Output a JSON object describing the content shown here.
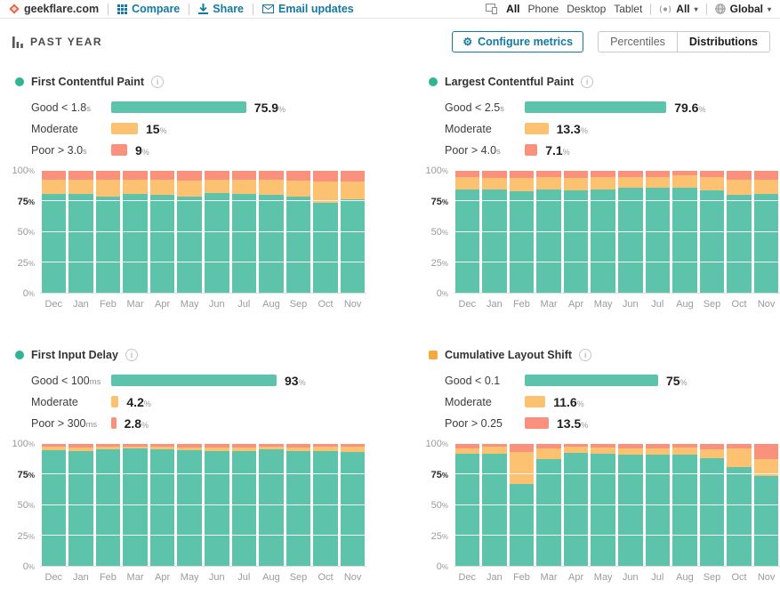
{
  "topbar": {
    "site": "geekflare.com",
    "links": [
      {
        "label": "Compare",
        "icon": "grid-icon"
      },
      {
        "label": "Share",
        "icon": "download-icon"
      },
      {
        "label": "Email updates",
        "icon": "envelope-icon"
      }
    ],
    "device_tabs": [
      {
        "label": "All",
        "selected": true
      },
      {
        "label": "Phone",
        "selected": false
      },
      {
        "label": "Desktop",
        "selected": false
      },
      {
        "label": "Tablet",
        "selected": false
      }
    ],
    "connection_dropdown": "All",
    "region_dropdown": "Global"
  },
  "toolbar": {
    "period": "PAST YEAR",
    "configure_label": "Configure metrics",
    "view_tabs": [
      {
        "label": "Percentiles",
        "selected": false
      },
      {
        "label": "Distributions",
        "selected": true
      }
    ]
  },
  "icons": {
    "gear": "⚙",
    "caret": "▾",
    "info": "i"
  },
  "colors": {
    "good": "#5ec3ab",
    "moderate": "#fcc171",
    "poor": "#f9917d",
    "accent": "#1379a2",
    "vitals_dot": "#2eb593",
    "cls_dot": "#f5a93f"
  },
  "y_ticks": [
    "100",
    "75",
    "50",
    "25",
    "0"
  ],
  "months": [
    "Dec",
    "Jan",
    "Feb",
    "Mar",
    "Apr",
    "May",
    "Jun",
    "Jul",
    "Aug",
    "Sep",
    "Oct",
    "Nov"
  ],
  "panels": [
    {
      "title": "First Contentful Paint",
      "marker_shape": "circle",
      "marker_color": "#2eb593",
      "legend": [
        {
          "label": "Good < 1.8",
          "unit": "s",
          "value": "75.9",
          "pct": 75.9,
          "color_key": "good"
        },
        {
          "label": "Moderate",
          "unit": "",
          "value": "15",
          "pct": 15,
          "color_key": "moderate"
        },
        {
          "label": "Poor > 3.0",
          "unit": "s",
          "value": "9",
          "pct": 9,
          "color_key": "poor"
        }
      ]
    },
    {
      "title": "Largest Contentful Paint",
      "marker_shape": "circle",
      "marker_color": "#2eb593",
      "legend": [
        {
          "label": "Good < 2.5",
          "unit": "s",
          "value": "79.6",
          "pct": 79.6,
          "color_key": "good"
        },
        {
          "label": "Moderate",
          "unit": "",
          "value": "13.3",
          "pct": 13.3,
          "color_key": "moderate"
        },
        {
          "label": "Poor > 4.0",
          "unit": "s",
          "value": "7.1",
          "pct": 7.1,
          "color_key": "poor"
        }
      ]
    },
    {
      "title": "First Input Delay",
      "marker_shape": "circle",
      "marker_color": "#2eb593",
      "legend": [
        {
          "label": "Good < 100",
          "unit": "ms",
          "value": "93",
          "pct": 93,
          "color_key": "good"
        },
        {
          "label": "Moderate",
          "unit": "",
          "value": "4.2",
          "pct": 4.2,
          "color_key": "moderate"
        },
        {
          "label": "Poor > 300",
          "unit": "ms",
          "value": "2.8",
          "pct": 2.8,
          "color_key": "poor"
        }
      ]
    },
    {
      "title": "Cumulative Layout Shift",
      "marker_shape": "square",
      "marker_color": "#f5a93f",
      "legend": [
        {
          "label": "Good < 0.1",
          "unit": "",
          "value": "75",
          "pct": 75,
          "color_key": "good"
        },
        {
          "label": "Moderate",
          "unit": "",
          "value": "11.6",
          "pct": 11.6,
          "color_key": "moderate"
        },
        {
          "label": "Poor > 0.25",
          "unit": "",
          "value": "13.5",
          "pct": 13.5,
          "color_key": "poor"
        }
      ]
    }
  ],
  "chart_data": [
    {
      "type": "bar",
      "stacked": true,
      "title": "First Contentful Paint distribution by month",
      "categories": [
        "Dec",
        "Jan",
        "Feb",
        "Mar",
        "Apr",
        "May",
        "Jun",
        "Jul",
        "Aug",
        "Sep",
        "Oct",
        "Nov"
      ],
      "series": [
        {
          "name": "Good",
          "values": [
            81,
            81,
            79,
            81,
            80,
            79,
            82,
            81,
            80,
            79,
            74,
            77
          ]
        },
        {
          "name": "Moderate",
          "values": [
            12,
            12,
            14,
            12,
            13,
            13,
            11,
            12,
            13,
            13,
            17,
            14
          ]
        },
        {
          "name": "Poor",
          "values": [
            7,
            7,
            7,
            7,
            7,
            8,
            7,
            7,
            7,
            8,
            9,
            9
          ]
        }
      ],
      "ylabel": "",
      "xlabel": "",
      "ylim": [
        0,
        100
      ],
      "grid": true,
      "legend_position": "none"
    },
    {
      "type": "bar",
      "stacked": true,
      "title": "Largest Contentful Paint distribution by month",
      "categories": [
        "Dec",
        "Jan",
        "Feb",
        "Mar",
        "Apr",
        "May",
        "Jun",
        "Jul",
        "Aug",
        "Sep",
        "Oct",
        "Nov"
      ],
      "series": [
        {
          "name": "Good",
          "values": [
            85,
            85,
            83,
            85,
            84,
            85,
            86,
            86,
            86,
            84,
            80,
            81
          ]
        },
        {
          "name": "Moderate",
          "values": [
            10,
            9,
            11,
            10,
            10,
            10,
            9,
            9,
            10,
            11,
            13,
            12
          ]
        },
        {
          "name": "Poor",
          "values": [
            5,
            6,
            6,
            5,
            6,
            5,
            5,
            5,
            4,
            5,
            7,
            7
          ]
        }
      ],
      "ylabel": "",
      "xlabel": "",
      "ylim": [
        0,
        100
      ],
      "grid": true,
      "legend_position": "none"
    },
    {
      "type": "bar",
      "stacked": true,
      "title": "First Input Delay distribution by month",
      "categories": [
        "Dec",
        "Jan",
        "Feb",
        "Mar",
        "Apr",
        "May",
        "Jun",
        "Jul",
        "Aug",
        "Sep",
        "Oct",
        "Nov"
      ],
      "series": [
        {
          "name": "Good",
          "values": [
            95,
            94.5,
            95.5,
            96,
            95.5,
            95,
            94.5,
            94.5,
            95.5,
            94.5,
            94,
            93.5
          ]
        },
        {
          "name": "Moderate",
          "values": [
            2.5,
            2.5,
            2,
            2,
            2,
            2,
            2.5,
            2.5,
            2,
            2.5,
            3.5,
            4
          ]
        },
        {
          "name": "Poor",
          "values": [
            2.5,
            3,
            2.5,
            2,
            2.5,
            3,
            3,
            3,
            2.5,
            3,
            2.5,
            2.5
          ]
        }
      ],
      "ylabel": "",
      "xlabel": "",
      "ylim": [
        0,
        100
      ],
      "grid": true,
      "legend_position": "none"
    },
    {
      "type": "bar",
      "stacked": true,
      "title": "Cumulative Layout Shift distribution by month",
      "categories": [
        "Dec",
        "Jan",
        "Feb",
        "Mar",
        "Apr",
        "May",
        "Jun",
        "Jul",
        "Aug",
        "Sep",
        "Oct",
        "Nov"
      ],
      "series": [
        {
          "name": "Good",
          "values": [
            92,
            92,
            67.5,
            87.5,
            93,
            92,
            91.5,
            91.5,
            91.5,
            88,
            81,
            73.5
          ]
        },
        {
          "name": "Moderate",
          "values": [
            4.5,
            5.5,
            26,
            8.5,
            4.5,
            5,
            5,
            5,
            5.5,
            7.5,
            15.5,
            14
          ]
        },
        {
          "name": "Poor",
          "values": [
            3.5,
            2.5,
            6.5,
            4,
            2.5,
            3,
            3.5,
            3.5,
            3,
            4.5,
            3.5,
            12.5
          ]
        }
      ],
      "ylabel": "",
      "xlabel": "",
      "ylim": [
        0,
        100
      ],
      "grid": true,
      "legend_position": "none"
    }
  ]
}
